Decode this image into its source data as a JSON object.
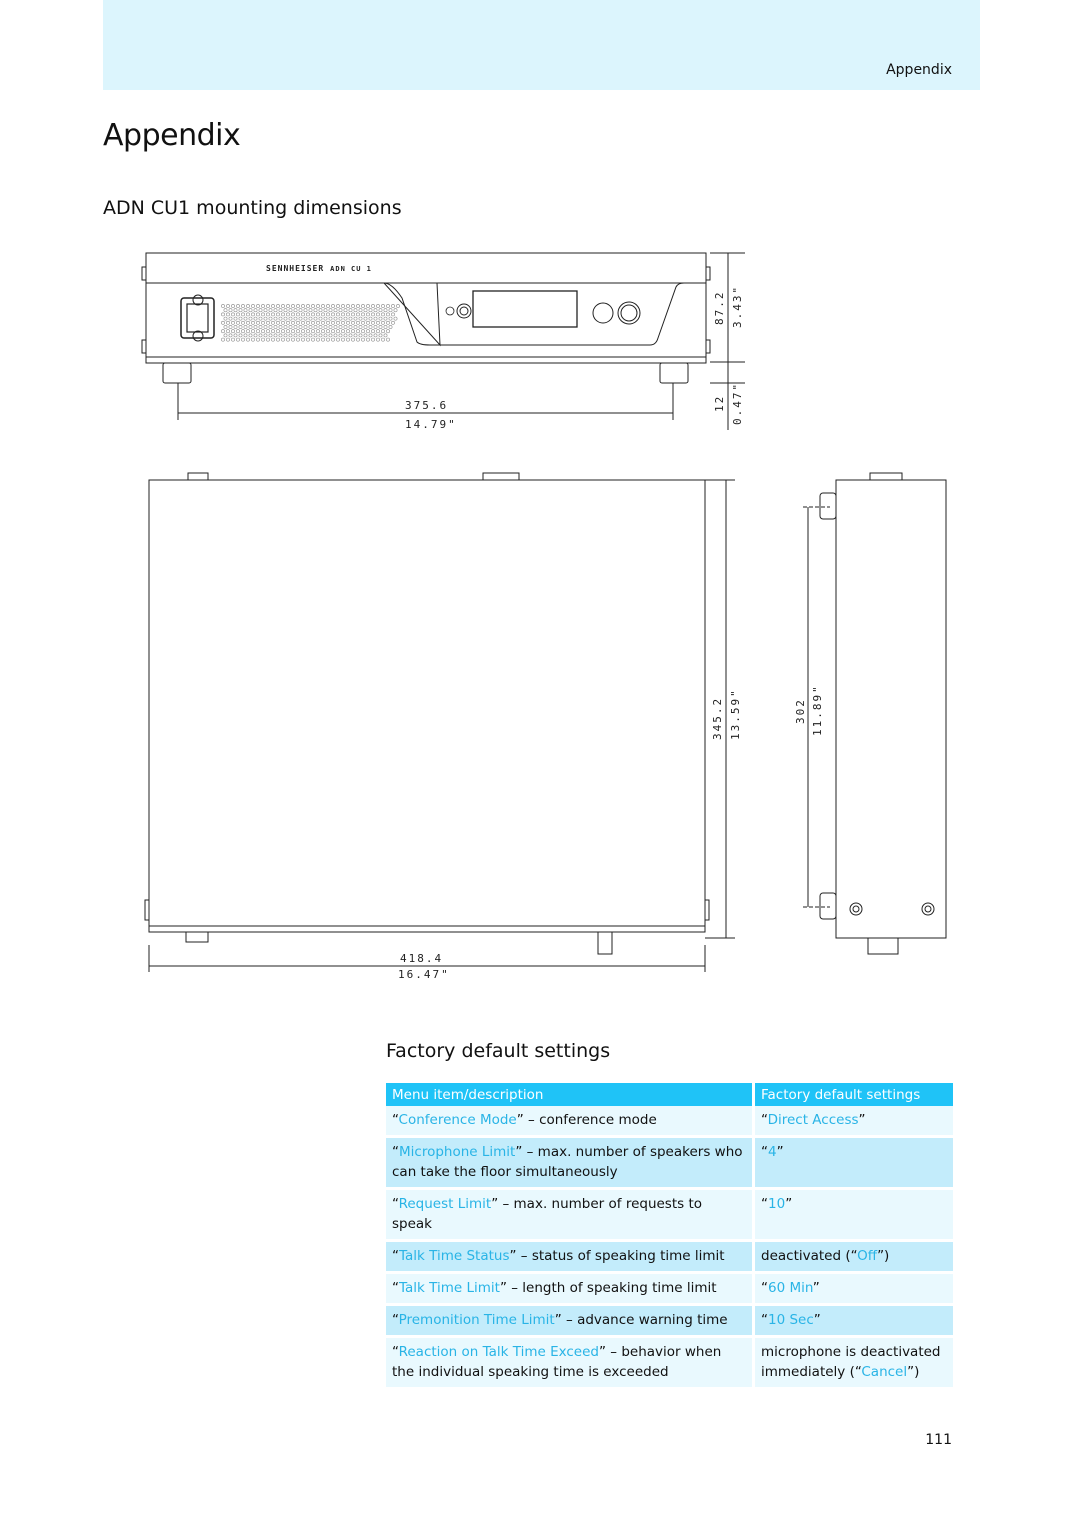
{
  "header": {
    "section_label": "Appendix"
  },
  "page_title": "Appendix",
  "mounting": {
    "title": "ADN CU1 mounting dimensions",
    "device_label": "ADN CU 1",
    "brand": "SENNHEISER",
    "front_view": {
      "width_mm": "375.6",
      "width_in": "14.79\"",
      "height_mm": "87.2",
      "height_in": "3.43\"",
      "foot_mm": "12",
      "foot_in": "0.47\""
    },
    "top_view": {
      "width_mm": "418.4",
      "width_in": "16.47\"",
      "depth_mm": "345.2",
      "depth_in": "13.59\""
    },
    "side_view": {
      "foot_spacing_mm": "302",
      "foot_spacing_in": "11.89\""
    }
  },
  "factory": {
    "title": "Factory default settings",
    "columns": [
      "Menu item/description",
      "Factory default settings"
    ],
    "rows": [
      {
        "style": "light",
        "item": "Conference Mode",
        "desc": " – conference mode",
        "pre": "",
        "value": "Direct Access",
        "post": "”",
        "vpre": "“"
      },
      {
        "style": "dark",
        "item": "Microphone Limit",
        "desc": " – max. number of speakers who can take the floor simultaneously",
        "pre": "",
        "value": "4",
        "post": "”",
        "vpre": "“"
      },
      {
        "style": "light",
        "item": "Request Limit",
        "desc": " – max. number of requests to speak",
        "pre": "",
        "value": "10",
        "post": "”",
        "vpre": "“"
      },
      {
        "style": "dark",
        "item": "Talk Time Status",
        "desc": " – status of speaking time limit",
        "pre": "",
        "value": "Off",
        "post": "”)",
        "vpre": "deactivated (“"
      },
      {
        "style": "light",
        "item": "Talk Time Limit",
        "desc": " – length of speaking time limit",
        "pre": "",
        "value": "60 Min",
        "post": "”",
        "vpre": "“"
      },
      {
        "style": "dark",
        "item": "Premonition Time Limit",
        "desc": " – advance warning time",
        "pre": " ",
        "value": "10 Sec",
        "post": "”",
        "vpre": "“"
      },
      {
        "style": "light",
        "item": "Reaction on Talk Time Exceed",
        "desc": " – behavior when the individual speaking time is exceeded",
        "pre": "",
        "value": "Cancel",
        "post": "”)",
        "vpre": "microphone is deactivated immediately (“"
      }
    ]
  },
  "page_number": "111"
}
